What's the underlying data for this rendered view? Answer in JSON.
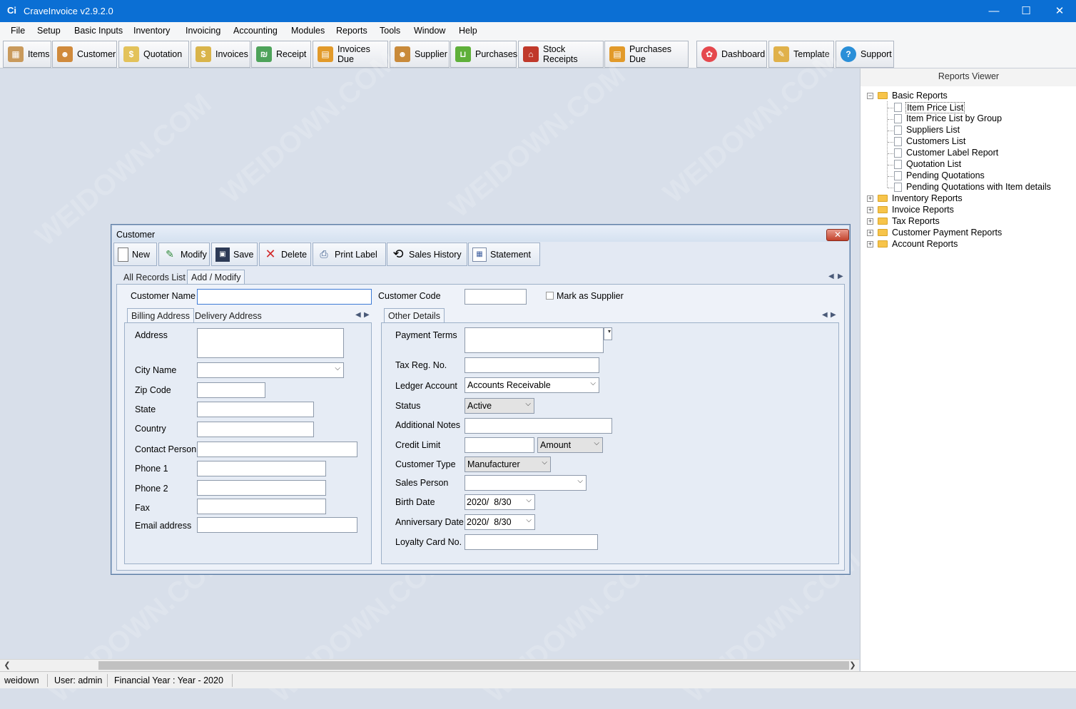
{
  "window": {
    "app_icon": "Ci",
    "title": "CraveInvoice v2.9.2.0",
    "controls": {
      "minimize": "—",
      "maximize": "☐",
      "close": "✕"
    }
  },
  "menu": [
    "File",
    "Setup",
    "Basic Inputs",
    "Inventory",
    "Invoicing",
    "Accounting",
    "Modules",
    "Reports",
    "Tools",
    "Window",
    "Help"
  ],
  "toolbar": [
    {
      "label": "Items",
      "icon": "items-icon",
      "color": "#c99a5c"
    },
    {
      "label": "Customer",
      "icon": "customer-icon",
      "color": "#d08a3c"
    },
    {
      "label": "Quotation",
      "icon": "quotation-icon",
      "color": "#e3c25a"
    },
    {
      "label": "Invoices",
      "icon": "invoices-icon",
      "color": "#d9b44a"
    },
    {
      "label": "Receipt",
      "icon": "receipt-icon",
      "color": "#4ea35a"
    },
    {
      "label": "Invoices Due",
      "icon": "invoices-due-icon",
      "color": "#e29a2a"
    },
    {
      "label": "Supplier",
      "icon": "supplier-icon",
      "color": "#c98a3a"
    },
    {
      "label": "Purchases",
      "icon": "purchases-icon",
      "color": "#5fb03a"
    },
    {
      "label": "Stock Receipts",
      "icon": "stock-receipts-icon",
      "color": "#c0392b"
    },
    {
      "label": "Purchases Due",
      "icon": "purchases-due-icon",
      "color": "#e29a2a"
    },
    {
      "label": "Dashboard",
      "icon": "dashboard-icon",
      "color": "#e5484d"
    },
    {
      "label": "Template",
      "icon": "template-icon",
      "color": "#e0b14a"
    },
    {
      "label": "Support",
      "icon": "support-icon",
      "color": "#2a8fd8"
    }
  ],
  "reports": {
    "header": "Reports Viewer",
    "groups": [
      {
        "label": "Basic Reports",
        "expanded": true,
        "items": [
          "Item Price List",
          "Item Price List by Group",
          "Suppliers List",
          "Customers List",
          "Customer Label Report",
          "Quotation List",
          "Pending Quotations",
          "Pending Quotations with Item details"
        ]
      },
      {
        "label": "Inventory Reports",
        "expanded": false
      },
      {
        "label": "Invoice Reports",
        "expanded": false
      },
      {
        "label": "Tax Reports",
        "expanded": false
      },
      {
        "label": "Customer Payment Reports",
        "expanded": false
      },
      {
        "label": "Account Reports",
        "expanded": false
      }
    ]
  },
  "customer": {
    "title": "Customer",
    "close_glyph": "✕",
    "buttons": [
      "New",
      "Modify",
      "Save",
      "Delete",
      "Print Label",
      "Sales History",
      "Statement"
    ],
    "tabs": [
      "All Records List",
      "Add / Modify"
    ],
    "customer_name_label": "Customer Name",
    "customer_name_value": "",
    "customer_code_label": "Customer Code",
    "customer_code_value": "",
    "mark_supplier_label": "Mark as Supplier",
    "address_tabs": [
      "Billing Address",
      "Delivery Address"
    ],
    "address_fields": {
      "address": "Address",
      "city": "City Name",
      "zip": "Zip Code",
      "state": "State",
      "country": "Country",
      "contact": "Contact Person",
      "phone1": "Phone 1",
      "phone2": "Phone 2",
      "fax": "Fax",
      "email": "Email address"
    },
    "other_tab": "Other Details",
    "other": {
      "payment_terms": "Payment Terms",
      "tax_reg": "Tax Reg. No.",
      "ledger_account": "Ledger Account",
      "ledger_account_value": "Accounts Receivable",
      "status": "Status",
      "status_value": "Active",
      "additional_notes": "Additional Notes",
      "credit_limit": "Credit Limit",
      "credit_limit_type": "Amount",
      "customer_type": "Customer Type",
      "customer_type_value": "Manufacturer",
      "sales_person": "Sales Person",
      "birth_date": "Birth Date",
      "birth_date_value": "2020/  8/30",
      "anniversary_date": "Anniversary Date",
      "anniversary_date_value": "2020/  8/30",
      "loyalty_card": "Loyalty Card No."
    }
  },
  "status": {
    "machine": "weidown",
    "user": "User: admin",
    "year": "Financial Year : Year - 2020"
  }
}
